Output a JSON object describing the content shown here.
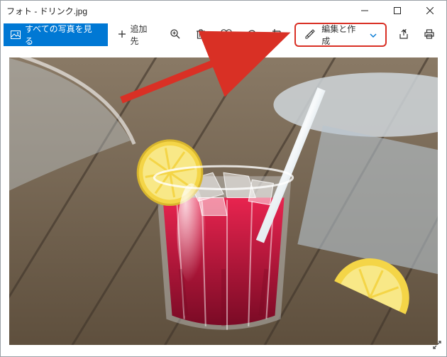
{
  "window": {
    "title": "フォト - ドリンク.jpg"
  },
  "toolbar": {
    "see_all_label": "すべての写真を見る",
    "add_to_label": "追加先",
    "edit_create_label": "編集と作成"
  }
}
